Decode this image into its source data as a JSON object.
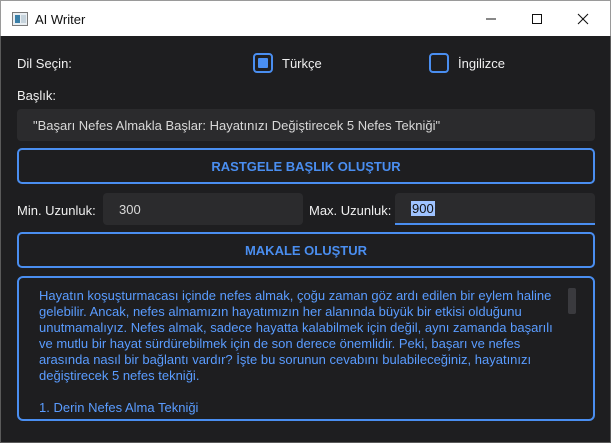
{
  "window": {
    "title": "AI Writer"
  },
  "language": {
    "label": "Dil Seçin:",
    "options": [
      {
        "label": "Türkçe",
        "checked": true
      },
      {
        "label": "İngilizce",
        "checked": false
      }
    ]
  },
  "heading": {
    "label": "Başlık:",
    "value": "\"Başarı Nefes Almakla Başlar: Hayatınızı Değiştirecek 5 Nefes Tekniği\""
  },
  "random_title_button": "RASTGELE BAŞLIK OLUŞTUR",
  "length": {
    "min_label": "Min. Uzunluk:",
    "min_value": "300",
    "max_label": "Max. Uzunluk:",
    "max_value": "900"
  },
  "generate_article_button": "MAKALE OLUŞTUR",
  "article": {
    "paragraph": "Hayatın koşuşturmacası içinde nefes almak, çoğu zaman göz ardı edilen bir eylem haline gelebilir. Ancak, nefes almamızın hayatımızın her alanında büyük bir etkisi olduğunu unutmamalıyız. Nefes almak, sadece hayatta kalabilmek için değil, aynı zamanda başarılı ve mutlu bir hayat sürdürebilmek için de son derece önemlidir. Peki, başarı ve nefes arasında nasıl bir bağlantı vardır? İşte bu sorunun cevabını bulabileceğiniz, hayatınızı değiştirecek 5 nefes tekniği.",
    "section": "1. Derin Nefes Alma Tekniği"
  },
  "colors": {
    "accent": "#4a8ef0",
    "background": "#1e1e20",
    "field": "#2b2b2d"
  }
}
